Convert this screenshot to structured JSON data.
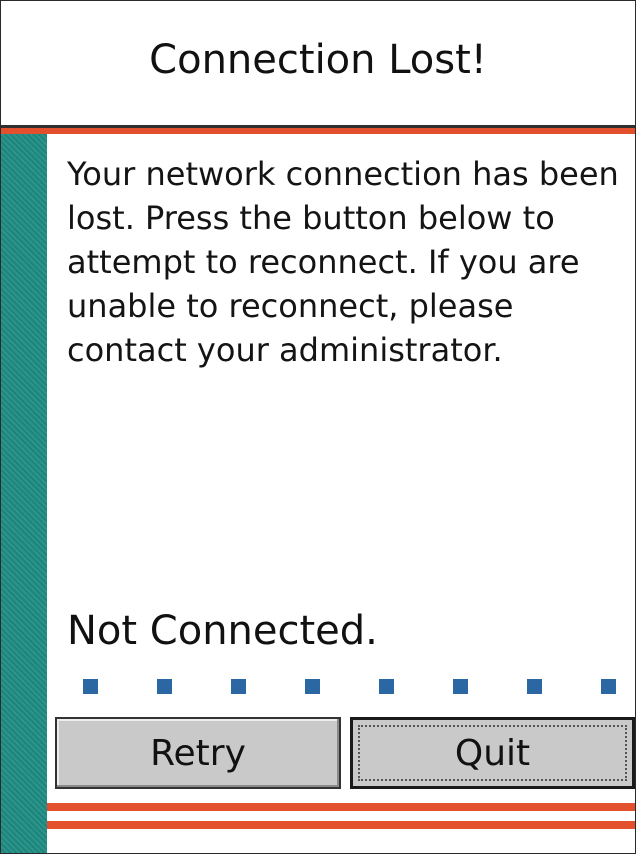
{
  "dialog": {
    "title": "Connection Lost!",
    "message": "Your network connection has been lost. Press the button below to attempt to reconnect. If you are unable to reconnect, please contact your administrator.",
    "status": "Not Connected.",
    "progress_dots": 8
  },
  "buttons": {
    "retry_label": "Retry",
    "quit_label": "Quit"
  },
  "colors": {
    "accent_teal": "#1f8d83",
    "stripe_red": "#e2502d",
    "dot_blue": "#2b67a3",
    "button_gray": "#c9c9c9"
  }
}
